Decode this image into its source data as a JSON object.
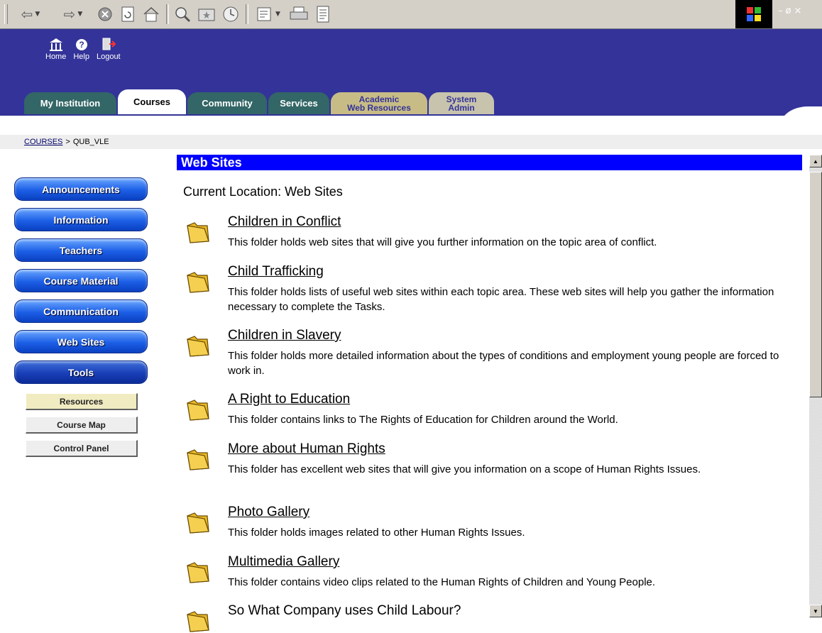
{
  "browser": {
    "toolbar_icons": [
      "back-icon",
      "forward-icon",
      "stop-icon",
      "refresh-icon",
      "home-icon",
      "search-icon",
      "favorites-icon",
      "history-icon",
      "mail-icon",
      "print-icon",
      "edit-icon"
    ]
  },
  "header": {
    "nav": [
      {
        "label": "Home",
        "icon": "home-icon"
      },
      {
        "label": "Help",
        "icon": "help-icon"
      },
      {
        "label": "Logout",
        "icon": "logout-icon"
      }
    ],
    "tabs": [
      {
        "label": "My Institution"
      },
      {
        "label": "Courses"
      },
      {
        "label": "Community"
      },
      {
        "label": "Services"
      },
      {
        "label_line1": "Academic",
        "label_line2": "Web Resources"
      },
      {
        "label_line1": "System",
        "label_line2": "Admin"
      }
    ]
  },
  "breadcrumb": {
    "link": "COURSES",
    "separator": ">",
    "current": "QUB_VLE"
  },
  "menu": {
    "items": [
      "Announcements",
      "Information",
      "Teachers",
      "Course Material",
      "Communication",
      "Web Sites",
      "Tools"
    ],
    "sub_items": [
      "Resources",
      "Course Map",
      "Control Panel"
    ]
  },
  "content": {
    "title": "Web Sites",
    "current_location": "Current Location: Web Sites",
    "items": [
      {
        "title": "Children in Conflict",
        "desc": "This folder holds web sites that will give you further information on the topic area of conflict."
      },
      {
        "title": "Child Trafficking",
        "desc": "This folder holds lists of useful web sites within each topic area. These web sites will help you gather the information necessary to complete the Tasks."
      },
      {
        "title": "Children in Slavery",
        "desc": "This folder holds more detailed information about the types of conditions and employment young people are forced to work in."
      },
      {
        "title": "A Right to Education",
        "desc": "This folder contains links to The Rights of Education for Children around the World."
      },
      {
        "title": "More about Human Rights",
        "desc": "This folder has excellent web sites that will give you information on a scope of Human Rights Issues."
      },
      {
        "title": "Photo Gallery",
        "desc": "This folder holds images related to other Human Rights Issues."
      },
      {
        "title": "Multimedia Gallery",
        "desc": "This folder contains video clips related to the Human Rights of Children and Young People."
      },
      {
        "title": "So What Company uses Child Labour?",
        "desc": ""
      }
    ]
  },
  "colors": {
    "header_bg": "#333399",
    "title_bar": "#0000ff",
    "tab_green": "#336666"
  }
}
